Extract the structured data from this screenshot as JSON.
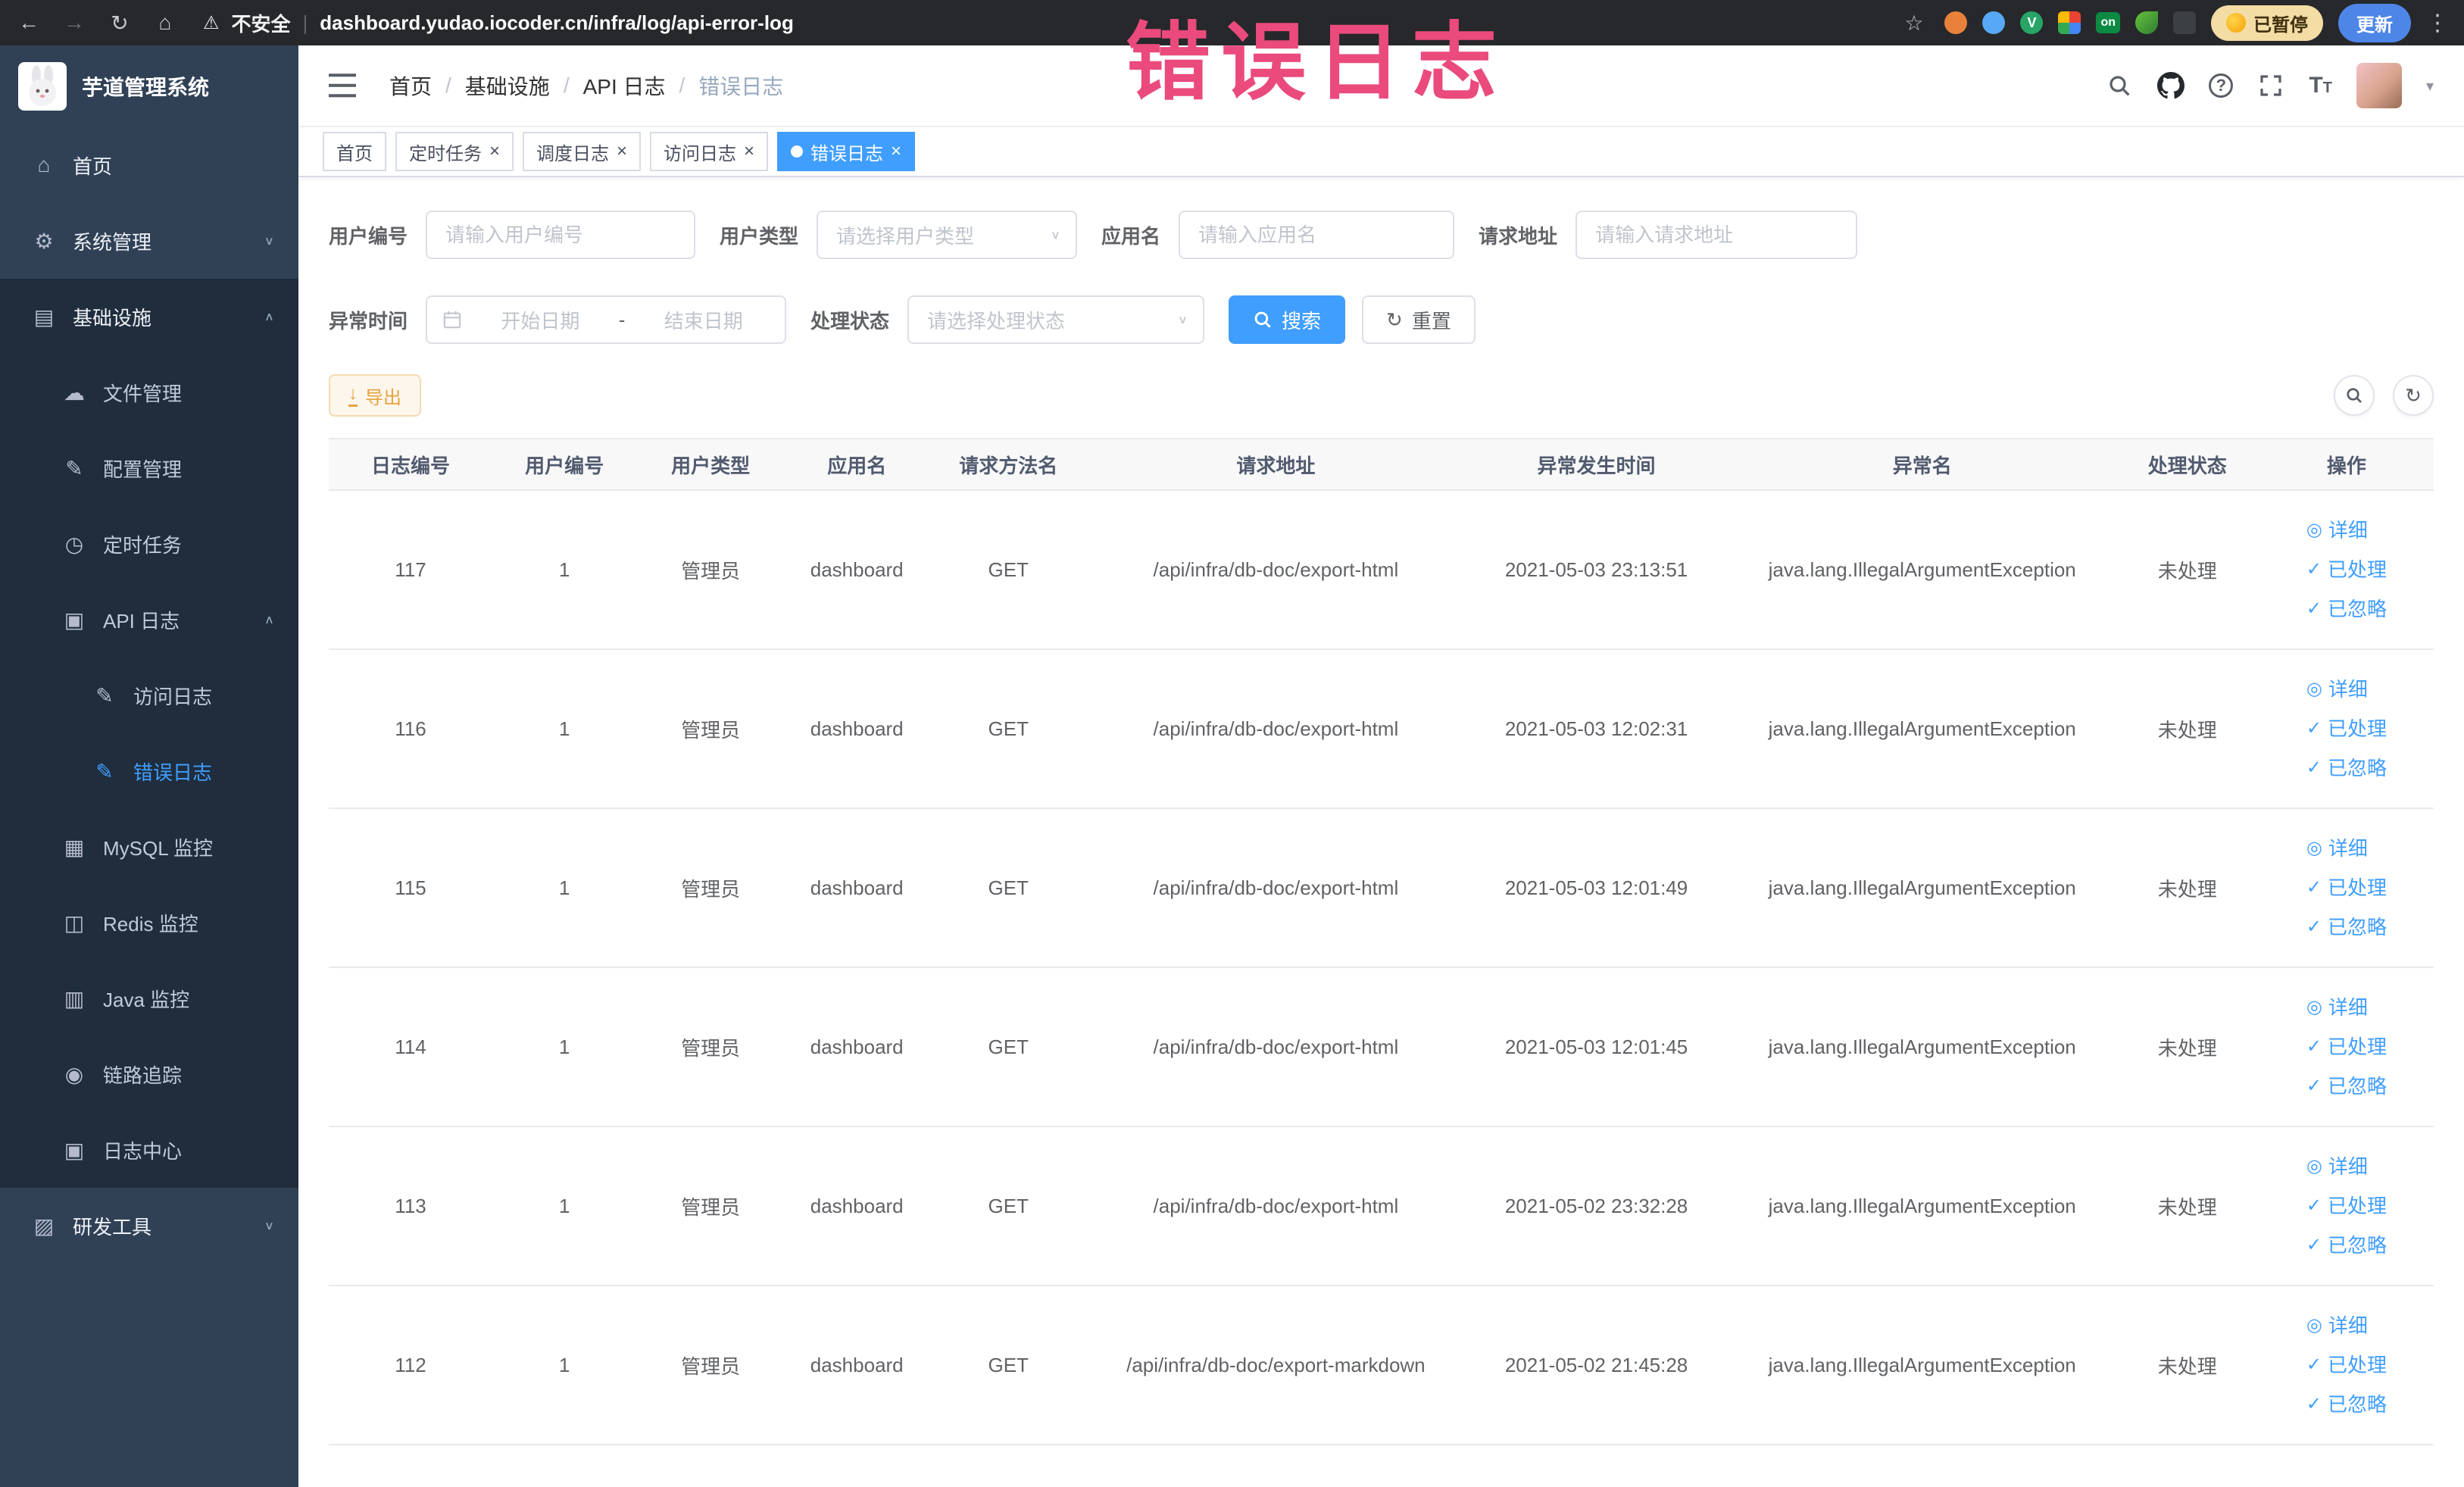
{
  "browser": {
    "security_label": "不安全",
    "url": "dashboard.yudao.iocoder.cn/infra/log/api-error-log",
    "extension_on_badge": "on",
    "paused_button": "已暂停",
    "update_button": "更新"
  },
  "annotation": "错误日志",
  "sidebar": {
    "app_title": "芋道管理系统",
    "items": [
      {
        "label": "首页",
        "icon": "dashboard",
        "level": 1
      },
      {
        "label": "系统管理",
        "icon": "gear",
        "level": 1,
        "chevron": "down"
      },
      {
        "label": "基础设施",
        "icon": "infrastructure",
        "level": 1,
        "chevron": "up",
        "open": true
      },
      {
        "label": "文件管理",
        "icon": "file",
        "level": 2
      },
      {
        "label": "配置管理",
        "icon": "config",
        "level": 2
      },
      {
        "label": "定时任务",
        "icon": "timer",
        "level": 2
      },
      {
        "label": "API 日志",
        "icon": "api-log",
        "level": 2,
        "chevron": "up"
      },
      {
        "label": "访问日志",
        "icon": "access-log",
        "level": 3
      },
      {
        "label": "错误日志",
        "icon": "error-log",
        "level": 3,
        "active": true
      },
      {
        "label": "MySQL 监控",
        "icon": "mysql",
        "level": 2
      },
      {
        "label": "Redis 监控",
        "icon": "redis",
        "level": 2
      },
      {
        "label": "Java 监控",
        "icon": "java",
        "level": 2
      },
      {
        "label": "链路追踪",
        "icon": "trace",
        "level": 2
      },
      {
        "label": "日志中心",
        "icon": "log-center",
        "level": 2
      },
      {
        "label": "研发工具",
        "icon": "tools",
        "level": 1,
        "chevron": "down"
      }
    ]
  },
  "header": {
    "breadcrumb": [
      "首页",
      "基础设施",
      "API 日志",
      "错误日志"
    ]
  },
  "tabs": [
    {
      "label": "首页",
      "closable": false,
      "active": false
    },
    {
      "label": "定时任务",
      "closable": true,
      "active": false
    },
    {
      "label": "调度日志",
      "closable": true,
      "active": false
    },
    {
      "label": "访问日志",
      "closable": true,
      "active": false
    },
    {
      "label": "错误日志",
      "closable": true,
      "active": true
    }
  ],
  "filters": {
    "user_id": {
      "label": "用户编号",
      "placeholder": "请输入用户编号"
    },
    "user_type": {
      "label": "用户类型",
      "placeholder": "请选择用户类型"
    },
    "app_name": {
      "label": "应用名",
      "placeholder": "请输入应用名"
    },
    "request_url": {
      "label": "请求地址",
      "placeholder": "请输入请求地址"
    },
    "exception_time": {
      "label": "异常时间",
      "start_placeholder": "开始日期",
      "separator": "-",
      "end_placeholder": "结束日期"
    },
    "process_status": {
      "label": "处理状态",
      "placeholder": "请选择处理状态"
    },
    "search_button": "搜索",
    "reset_button": "重置"
  },
  "toolbar": {
    "export_button": "导出"
  },
  "table": {
    "columns": [
      "日志编号",
      "用户编号",
      "用户类型",
      "应用名",
      "请求方法名",
      "请求地址",
      "异常发生时间",
      "异常名",
      "处理状态",
      "操作"
    ],
    "row_keys": [
      "id",
      "user_id",
      "user_type",
      "app_name",
      "method",
      "url",
      "time",
      "exception",
      "status"
    ],
    "rows": [
      {
        "id": "117",
        "user_id": "1",
        "user_type": "管理员",
        "app_name": "dashboard",
        "method": "GET",
        "url": "/api/infra/db-doc/export-html",
        "time": "2021-05-03 23:13:51",
        "exception": "java.lang.IllegalArgumentException",
        "status": "未处理"
      },
      {
        "id": "116",
        "user_id": "1",
        "user_type": "管理员",
        "app_name": "dashboard",
        "method": "GET",
        "url": "/api/infra/db-doc/export-html",
        "time": "2021-05-03 12:02:31",
        "exception": "java.lang.IllegalArgumentException",
        "status": "未处理"
      },
      {
        "id": "115",
        "user_id": "1",
        "user_type": "管理员",
        "app_name": "dashboard",
        "method": "GET",
        "url": "/api/infra/db-doc/export-html",
        "time": "2021-05-03 12:01:49",
        "exception": "java.lang.IllegalArgumentException",
        "status": "未处理"
      },
      {
        "id": "114",
        "user_id": "1",
        "user_type": "管理员",
        "app_name": "dashboard",
        "method": "GET",
        "url": "/api/infra/db-doc/export-html",
        "time": "2021-05-03 12:01:45",
        "exception": "java.lang.IllegalArgumentException",
        "status": "未处理"
      },
      {
        "id": "113",
        "user_id": "1",
        "user_type": "管理员",
        "app_name": "dashboard",
        "method": "GET",
        "url": "/api/infra/db-doc/export-html",
        "time": "2021-05-02 23:32:28",
        "exception": "java.lang.IllegalArgumentException",
        "status": "未处理"
      },
      {
        "id": "112",
        "user_id": "1",
        "user_type": "管理员",
        "app_name": "dashboard",
        "method": "GET",
        "url": "/api/infra/db-doc/export-markdown",
        "time": "2021-05-02 21:45:28",
        "exception": "java.lang.IllegalArgumentException",
        "status": "未处理"
      }
    ],
    "row_actions": [
      "详细",
      "已处理",
      "已忽略"
    ]
  },
  "icon_glyphs": {
    "dashboard": "⌂",
    "gear": "⚙",
    "infrastructure": "▤",
    "file": "☁",
    "config": "✎",
    "timer": "◷",
    "api-log": "▣",
    "access-log": "✎",
    "error-log": "✎",
    "mysql": "▦",
    "redis": "◫",
    "java": "▥",
    "trace": "◉",
    "log-center": "▣",
    "tools": "▨"
  },
  "colors": {
    "accent": "#409eff",
    "sidebar_bg": "#304156",
    "submenu_bg": "#1f2d3d",
    "annotation": "#ea4a7c",
    "warning_button": "#e6a23c"
  }
}
